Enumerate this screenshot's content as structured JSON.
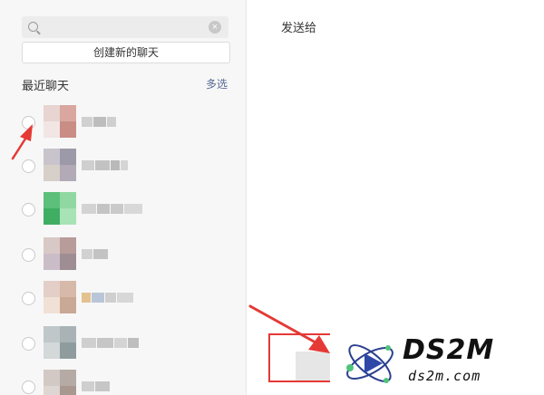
{
  "left_pane": {
    "search": {
      "value": "",
      "placeholder": ""
    },
    "create_button_label": "创建新的聊天",
    "section_title": "最近聊天",
    "multi_select_label": "多选",
    "chats": [
      {
        "avatar_colors": [
          "#e8d4d0",
          "#d9a7a0",
          "#f1e6e3",
          "#c98d86"
        ],
        "name_colors": [
          "#d0d0d0",
          "#bdbdbd",
          "#cfcfcf"
        ]
      },
      {
        "avatar_colors": [
          "#c9c3cc",
          "#9c99a8",
          "#d6d0c9",
          "#b2aab6"
        ],
        "name_colors": [
          "#cfcfcf",
          "#c2c2c2",
          "#b9b9b9",
          "#d5d5d5"
        ]
      },
      {
        "avatar_colors": [
          "#5cbf7a",
          "#8fd8a2",
          "#3fae63",
          "#a8e3b5"
        ],
        "name_colors": [
          "#d3d3d3",
          "#c4c4c4",
          "#cacaca",
          "#d8d8d8"
        ]
      },
      {
        "avatar_colors": [
          "#d8c9c6",
          "#b89c9a",
          "#cbbdc8",
          "#9e8e94"
        ],
        "name_colors": [
          "#d1d1d1",
          "#c3c3c3"
        ]
      },
      {
        "avatar_colors": [
          "#e3cfc8",
          "#d6b9a8",
          "#f0e0d6",
          "#c9a895"
        ],
        "name_colors": [
          "#e3c28f",
          "#b9c6d8",
          "#cfcfcf",
          "#d7d7d7"
        ]
      },
      {
        "avatar_colors": [
          "#c0c7c9",
          "#a9b3b5",
          "#d3d8d9",
          "#8f9c9e"
        ],
        "name_colors": [
          "#cfcfcf",
          "#c6c6c6",
          "#d4d4d4",
          "#bebebe"
        ]
      },
      {
        "avatar_colors": [
          "#d2c9c5",
          "#b6aaa4",
          "#ddd6d2",
          "#a89890"
        ],
        "name_colors": [
          "#cfcfcf",
          "#c6c6c6"
        ]
      }
    ]
  },
  "right_pane": {
    "title": "发送给"
  },
  "watermark": {
    "brand": "DS2M",
    "url": "ds2m.com"
  },
  "colors": {
    "annotation_red": "#e53935",
    "link_blue": "#576b95"
  }
}
